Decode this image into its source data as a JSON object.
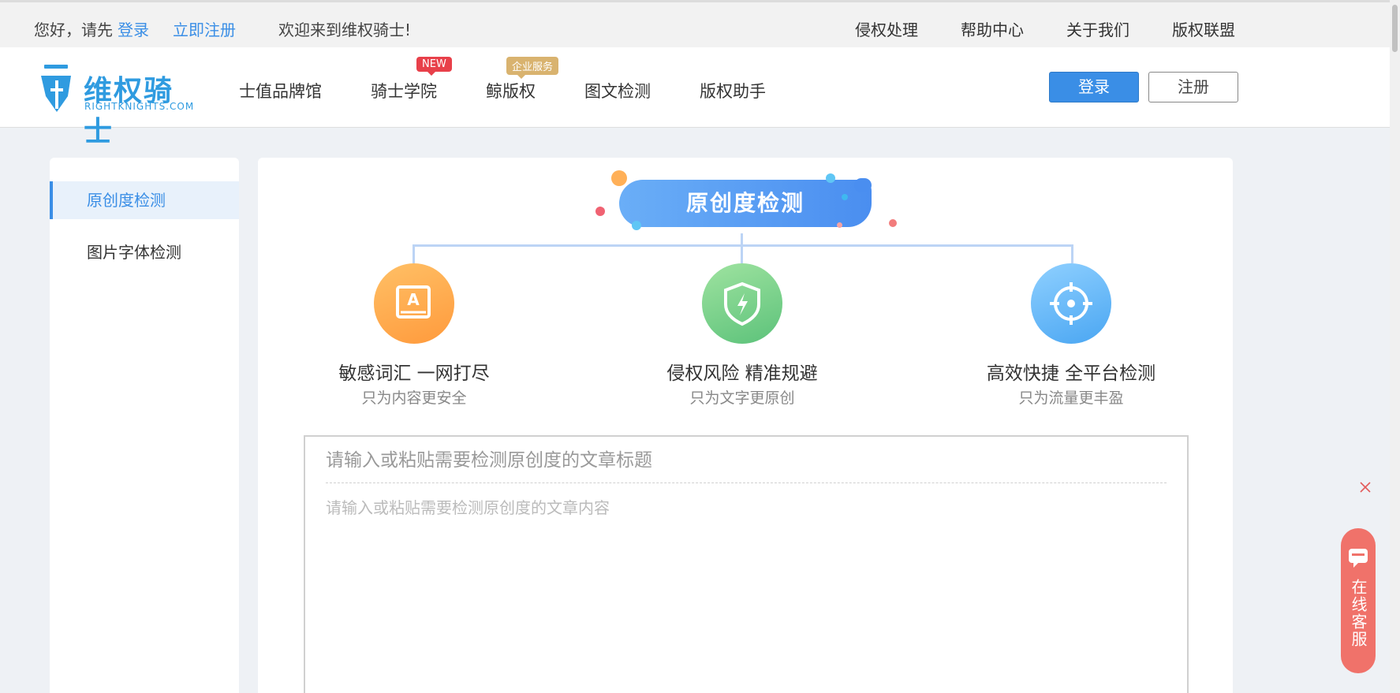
{
  "topbar": {
    "greeting": "您好，请先",
    "login_link": "登录",
    "register_link": "立即注册",
    "welcome": "欢迎来到维权骑士!",
    "links": [
      "侵权处理",
      "帮助中心",
      "关于我们",
      "版权联盟"
    ]
  },
  "header": {
    "logo_name": "维权骑士",
    "logo_sub": "RIGHTKNIGHTS.COM",
    "nav": [
      {
        "label": "士值品牌馆",
        "badge": ""
      },
      {
        "label": "骑士学院",
        "badge": "NEW"
      },
      {
        "label": "鲸版权",
        "badge": "企业服务"
      },
      {
        "label": "图文检测",
        "badge": ""
      },
      {
        "label": "版权助手",
        "badge": ""
      }
    ],
    "login_button": "登录",
    "register_button": "注册"
  },
  "sidebar": {
    "items": [
      {
        "label": "原创度检测",
        "active": true
      },
      {
        "label": "图片字体检测",
        "active": false
      }
    ]
  },
  "main": {
    "hero_title": "原创度检测",
    "features": [
      {
        "title": "敏感词汇 一网打尽",
        "subtitle": "只为内容更安全",
        "icon": "book-icon",
        "color_from": "#ffc066",
        "color_to": "#ff9a3c"
      },
      {
        "title": "侵权风险 精准规避",
        "subtitle": "只为文字更原创",
        "icon": "shield-bolt-icon",
        "color_from": "#9fe3a0",
        "color_to": "#5cc27a"
      },
      {
        "title": "高效快捷 全平台检测",
        "subtitle": "只为流量更丰盈",
        "icon": "target-icon",
        "color_from": "#8fd0ff",
        "color_to": "#4aa6f2"
      }
    ],
    "title_placeholder": "请输入或粘贴需要检测原创度的文章标题",
    "content_placeholder": "请输入或粘贴需要检测原创度的文章内容"
  },
  "widgets": {
    "service_label": "在线客服"
  },
  "colors": {
    "accent": "#3a8ee6",
    "service": "#f0726a"
  }
}
